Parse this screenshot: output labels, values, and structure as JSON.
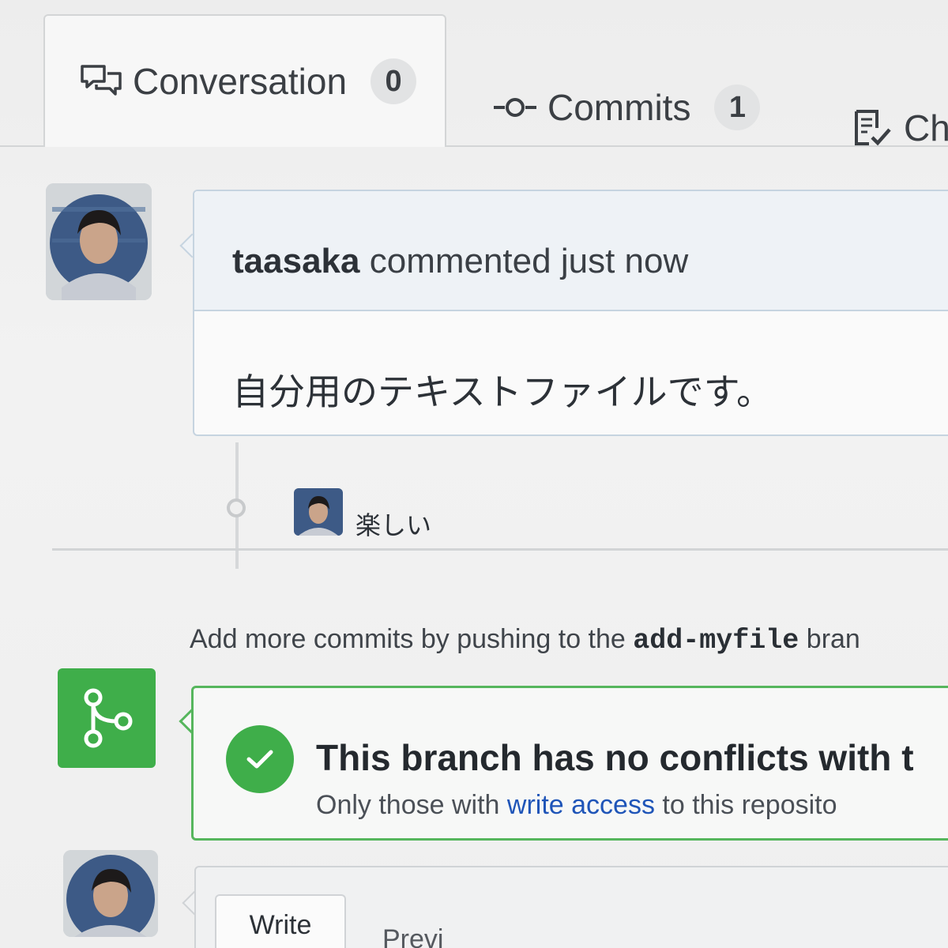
{
  "tabs": {
    "conversation": {
      "label": "Conversation",
      "count": "0",
      "icon": "comment-discussion-icon"
    },
    "commits": {
      "label": "Commits",
      "count": "1",
      "icon": "git-commit-icon"
    },
    "checks": {
      "label": "Ch",
      "icon": "checklist-icon"
    }
  },
  "comment": {
    "author": "taasaka",
    "action": "commented",
    "time": "just now",
    "body": "自分用のテキストファイルです。"
  },
  "commit": {
    "message": "楽しい"
  },
  "hint": {
    "prefix": "Add more commits by pushing to the",
    "branch": "add-myfile",
    "suffix": "bran"
  },
  "merge": {
    "title": "This branch has no conflicts with t",
    "sub_prefix": "Only those with",
    "sub_link": "write access",
    "sub_suffix": "to this reposito",
    "icon": "git-merge-icon",
    "status_icon": "check-icon"
  },
  "form": {
    "write_tab": "Write",
    "preview_tab": "Previ"
  },
  "colors": {
    "success": "#3fae4a",
    "link": "#1f55b8",
    "header_bg": "#eef2f6"
  }
}
